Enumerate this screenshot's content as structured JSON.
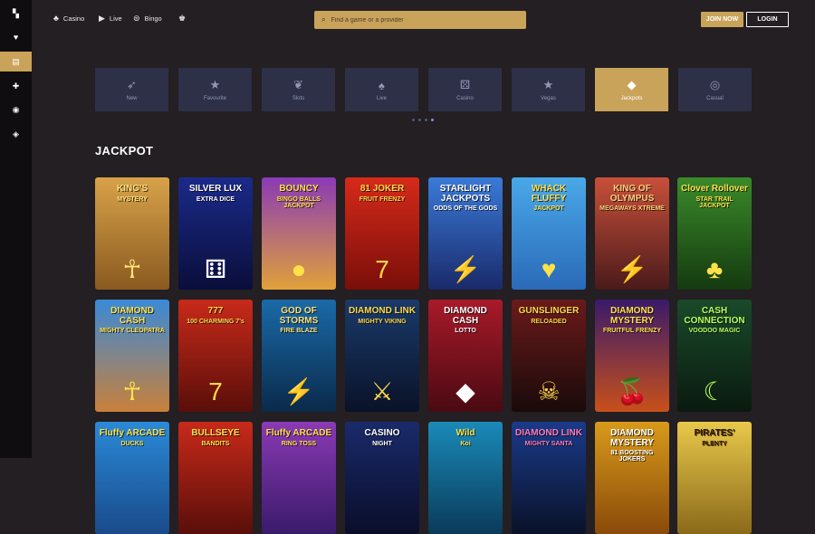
{
  "nav": {
    "casino": "Casino",
    "live": "Live",
    "bingo": "Bingo"
  },
  "search": {
    "placeholder": "Find a game or a provider"
  },
  "auth": {
    "join": "JOIN NOW",
    "login": "LOGIN"
  },
  "categories": [
    {
      "label": "New",
      "icon": "rocket-icon"
    },
    {
      "label": "Favourite",
      "icon": "star-icon"
    },
    {
      "label": "Slots",
      "icon": "cherries-icon"
    },
    {
      "label": "Live",
      "icon": "cards-icon"
    },
    {
      "label": "Casino",
      "icon": "dice-icon"
    },
    {
      "label": "Vegas",
      "icon": "star-icon"
    },
    {
      "label": "Jackpots",
      "icon": "diamond-icon"
    },
    {
      "label": "Casual",
      "icon": "chip-icon"
    }
  ],
  "active_category": "Jackpots",
  "carousel": {
    "pages": 4,
    "active_page": 4
  },
  "section": {
    "title": "JACKPOT"
  },
  "games_row1": [
    {
      "title": "KING'S",
      "subtitle": "MYSTERY",
      "bg1": "#d8a24a",
      "bg2": "#8a5a20",
      "color": "#ffe37a"
    },
    {
      "title": "SILVER LUX",
      "subtitle": "EXTRA DICE",
      "bg1": "#1b2a8a",
      "bg2": "#0a0e3a",
      "color": "#ffffff"
    },
    {
      "title": "BOUNCY",
      "subtitle": "BINGO BALLS JACKPOT",
      "bg1": "#8a3ab5",
      "bg2": "#e0a13a",
      "color": "#ffe14a"
    },
    {
      "title": "81 JOKER",
      "subtitle": "FRUIT FRENZY",
      "bg1": "#d62a1a",
      "bg2": "#7a0e0a",
      "color": "#ffd84a"
    },
    {
      "title": "STARLIGHT JACKPOTS",
      "subtitle": "ODDS OF THE GODS",
      "bg1": "#3a7ad8",
      "bg2": "#1a2a6a",
      "color": "#ffffff"
    },
    {
      "title": "WHACK FLUFFY",
      "subtitle": "JACKPOT",
      "bg1": "#4aa8e8",
      "bg2": "#2a6ab8",
      "color": "#ffe14a"
    },
    {
      "title": "KING OF OLYMPUS",
      "subtitle": "MEGAWAYS XTREME",
      "bg1": "#c8503a",
      "bg2": "#4a1a1a",
      "color": "#ffd07a"
    },
    {
      "title": "Clover Rollover",
      "subtitle": "STAR TRAIL JACKPOT",
      "bg1": "#3a8a2a",
      "bg2": "#153a10",
      "color": "#ffe14a"
    }
  ],
  "games_row2": [
    {
      "title": "DIAMOND CASH",
      "subtitle": "MIGHTY CLEOPATRA",
      "bg1": "#3a8ad8",
      "bg2": "#c8803a",
      "color": "#ffe14a"
    },
    {
      "title": "777",
      "subtitle": "100 CHARMING 7's",
      "bg1": "#c82a1a",
      "bg2": "#5a0e0a",
      "color": "#ffd84a"
    },
    {
      "title": "GOD OF STORMS",
      "subtitle": "FIRE BLAZE",
      "bg1": "#1a6aa8",
      "bg2": "#0a2a4a",
      "color": "#ffe07a"
    },
    {
      "title": "DIAMOND LINK",
      "subtitle": "MIGHTY VIKING",
      "bg1": "#1a3a6a",
      "bg2": "#0a1228",
      "color": "#ffd84a"
    },
    {
      "title": "DIAMOND CASH",
      "subtitle": "LOTTO",
      "bg1": "#a81a2a",
      "bg2": "#4a0a12",
      "color": "#ffffff"
    },
    {
      "title": "GUNSLINGER",
      "subtitle": "RELOADED",
      "bg1": "#6a1a1a",
      "bg2": "#1a0a0a",
      "color": "#ffd84a"
    },
    {
      "title": "DIAMOND MYSTERY",
      "subtitle": "FRUITFUL FRENZY",
      "bg1": "#3a1a6a",
      "bg2": "#c8501a",
      "color": "#ffe14a"
    },
    {
      "title": "CASH CONNECTION",
      "subtitle": "VOODOO MAGIC",
      "bg1": "#1a4a2a",
      "bg2": "#0a1a10",
      "color": "#b8ff5a"
    }
  ],
  "games_row3": [
    {
      "title": "Fluffy ARCADE",
      "subtitle": "DUCKS",
      "bg1": "#2a8ad8",
      "bg2": "#1a4a8a",
      "color": "#ffe14a"
    },
    {
      "title": "BULLSEYE",
      "subtitle": "BANDITS",
      "bg1": "#c82a1a",
      "bg2": "#5a0e0a",
      "color": "#ffe14a"
    },
    {
      "title": "Fluffy ARCADE",
      "subtitle": "RING TOSS",
      "bg1": "#8a3ab5",
      "bg2": "#3a1a6a",
      "color": "#ffe14a"
    },
    {
      "title": "CASINO",
      "subtitle": "NIGHT",
      "bg1": "#1a2a6a",
      "bg2": "#0a0e2a",
      "color": "#ffffff"
    },
    {
      "title": "Wild",
      "subtitle": "Koi",
      "bg1": "#1a8ab8",
      "bg2": "#0a3a5a",
      "color": "#ffe14a"
    },
    {
      "title": "DIAMOND LINK",
      "subtitle": "MIGHTY SANTA",
      "bg1": "#1a3a8a",
      "bg2": "#0a1228",
      "color": "#ff7ab8"
    },
    {
      "title": "DIAMOND MYSTERY",
      "subtitle": "81 BOOSTING JOKERS",
      "bg1": "#d89a1a",
      "bg2": "#8a4a0a",
      "color": "#ffffff"
    },
    {
      "title": "PIRATES'",
      "subtitle": "PLENTY",
      "bg1": "#e8c84a",
      "bg2": "#8a6a1a",
      "color": "#3a1a0a"
    }
  ],
  "colors": {
    "accent": "#c9a35a",
    "background": "#231f22",
    "sidebar": "#0f0d0f",
    "category_tile": "#2e3048"
  }
}
